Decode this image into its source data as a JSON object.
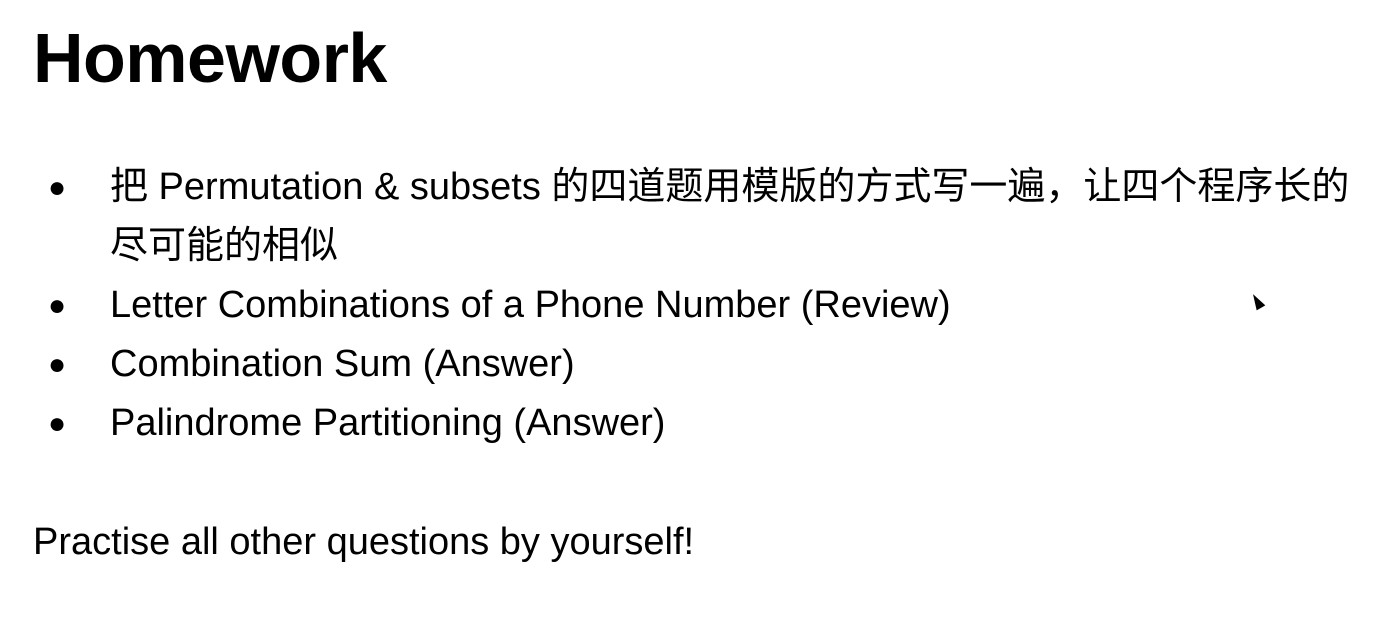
{
  "slide": {
    "title": "Homework",
    "items": [
      {
        "text": "把 Permutation & subsets 的四道题用模版的方式写一遍，让四个程序长的尽可能的相似"
      },
      {
        "text": "Letter Combinations of a Phone Number (Review)"
      },
      {
        "text": "Combination Sum (Answer)"
      },
      {
        "text": "Palindrome Partitioning (Answer)"
      }
    ],
    "bullet": "●",
    "footer": "Practise all other questions by yourself!"
  }
}
